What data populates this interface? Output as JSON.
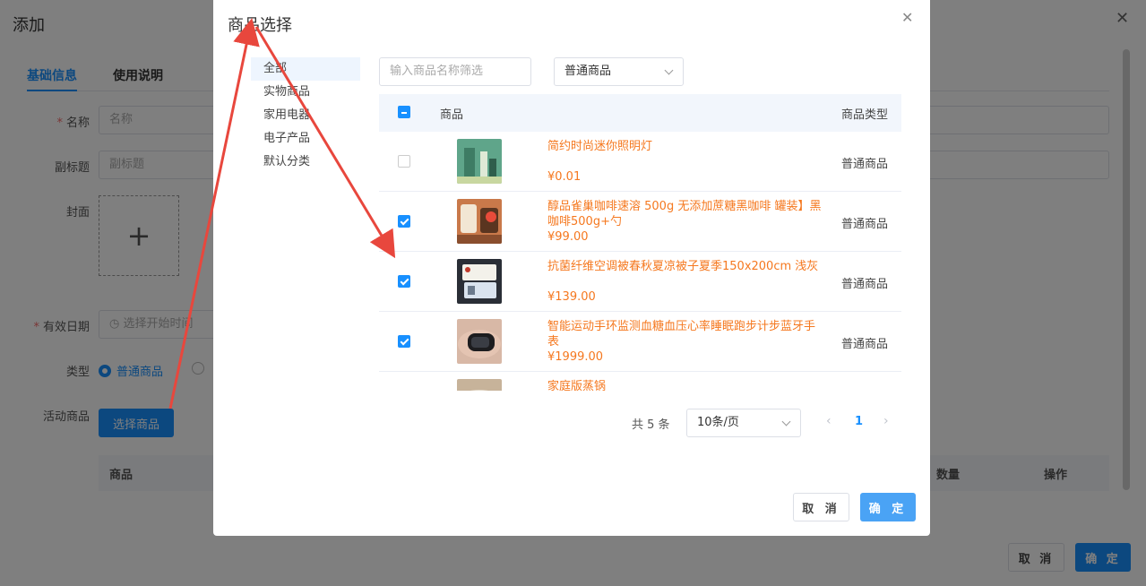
{
  "background": {
    "title": "添加",
    "tabs": [
      "基础信息",
      "使用说明"
    ],
    "labels": {
      "name": "名称",
      "subtitle": "副标题",
      "cover": "封面",
      "valid_date": "有效日期",
      "type": "类型",
      "activity_goods": "活动商品"
    },
    "placeholders": {
      "name": "名称",
      "subtitle": "副标题",
      "start_time": "选择开始时间"
    },
    "type_option": "普通商品",
    "select_goods_button": "选择商品",
    "table_headers": {
      "goods": "商品",
      "quantity": "数量",
      "action": "操作"
    },
    "cancel": "取 消",
    "confirm": "确 定"
  },
  "dialog": {
    "title": "商品选择",
    "categories": [
      "全部",
      "实物商品",
      "家用电器",
      "电子产品",
      "默认分类"
    ],
    "search_placeholder": "输入商品名称筛选",
    "type_filter": "普通商品",
    "table": {
      "col_goods": "商品",
      "col_type": "商品类型",
      "rows": [
        {
          "name": "简约时尚迷你照明灯",
          "price": "¥0.01",
          "type": "普通商品",
          "checked": false
        },
        {
          "name": "醇品雀巢咖啡速溶 500g 无添加蔗糖黑咖啡 罐装】黑咖啡500g+勺",
          "price": "¥99.00",
          "type": "普通商品",
          "checked": true
        },
        {
          "name": "抗菌纤维空调被春秋夏凉被子夏季150x200cm 浅灰",
          "price": "¥139.00",
          "type": "普通商品",
          "checked": true
        },
        {
          "name": "智能运动手环监测血糖血压心率睡眠跑步计步蓝牙手表",
          "price": "¥1999.00",
          "type": "普通商品",
          "checked": true
        },
        {
          "name": "家庭版蒸锅",
          "price": "",
          "type": "",
          "checked": false
        }
      ]
    },
    "pagination": {
      "total": "共 5 条",
      "page_size": "10条/页",
      "current_page": "1"
    },
    "cancel": "取 消",
    "confirm": "确 定"
  },
  "colors": {
    "primary": "#1890ff",
    "price": "#f5781f",
    "arrow": "#e8473d"
  }
}
